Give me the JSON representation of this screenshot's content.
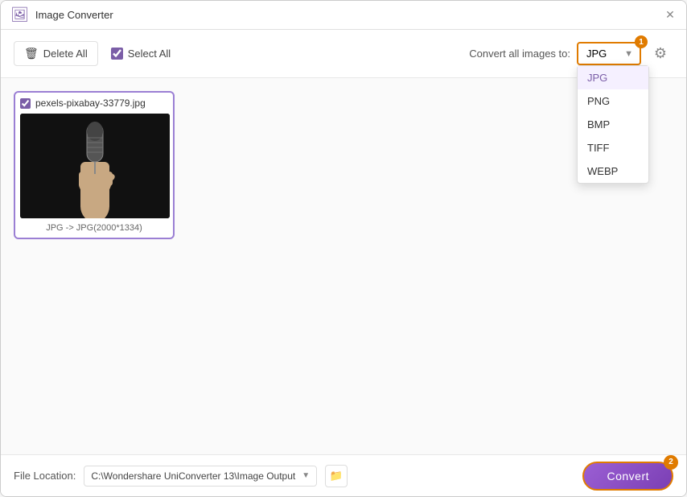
{
  "window": {
    "title": "Image Converter"
  },
  "toolbar": {
    "delete_all_label": "Delete All",
    "select_all_label": "Select All",
    "convert_label": "Convert all images to:",
    "format_selected": "JPG",
    "formats": [
      "JPG",
      "PNG",
      "BMP",
      "TIFF",
      "WEBP"
    ],
    "badge_1": "1"
  },
  "image_card": {
    "filename": "pexels-pixabay-33779.jpg",
    "caption": "JPG -> JPG(2000*1334)"
  },
  "footer": {
    "file_location_label": "File Location:",
    "file_path": "C:\\Wondershare UniConverter 13\\Image Output",
    "convert_btn_label": "Convert",
    "badge_2": "2"
  }
}
